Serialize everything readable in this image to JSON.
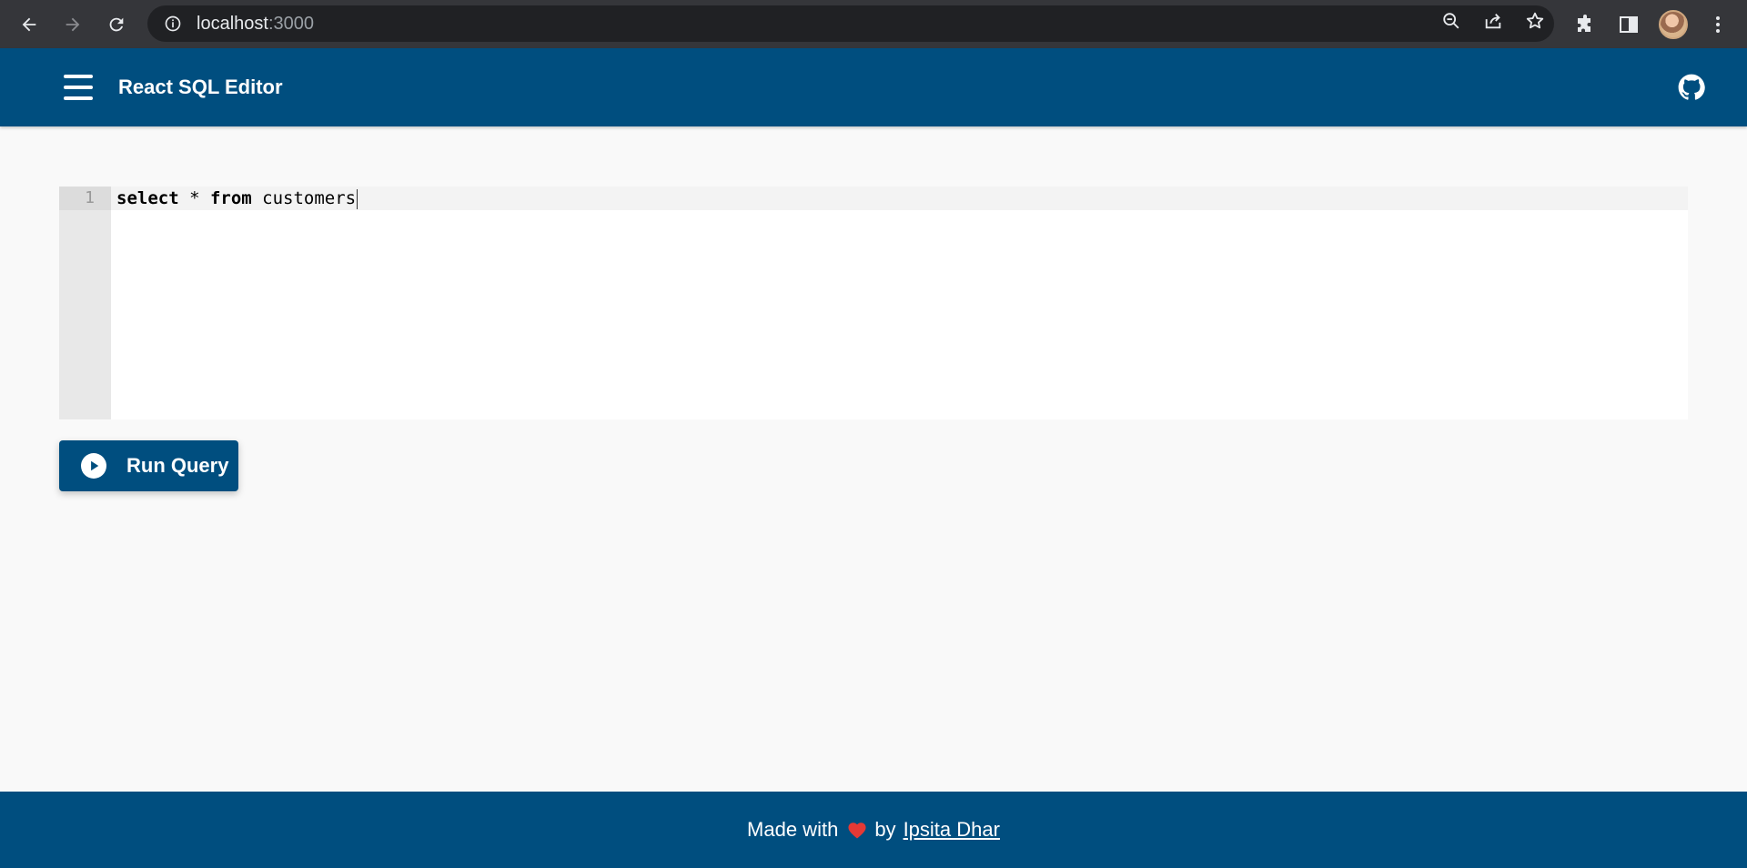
{
  "browser": {
    "url_host": "localhost",
    "url_port": ":3000"
  },
  "header": {
    "title": "React SQL Editor",
    "menu_icon": "hamburger-menu-icon",
    "repo_icon": "github-icon"
  },
  "editor": {
    "line_numbers": [
      "1"
    ],
    "lines": [
      {
        "keyword1": "select",
        "rest1": " * ",
        "keyword2": "from",
        "rest2": " customers"
      }
    ]
  },
  "actions": {
    "run_label": "Run Query",
    "run_icon": "play-circle-icon"
  },
  "footer": {
    "made_with": "Made with",
    "by": "by",
    "author": "Ipsita Dhar"
  },
  "colors": {
    "brand": "#004e7f",
    "heart": "#e53935"
  }
}
